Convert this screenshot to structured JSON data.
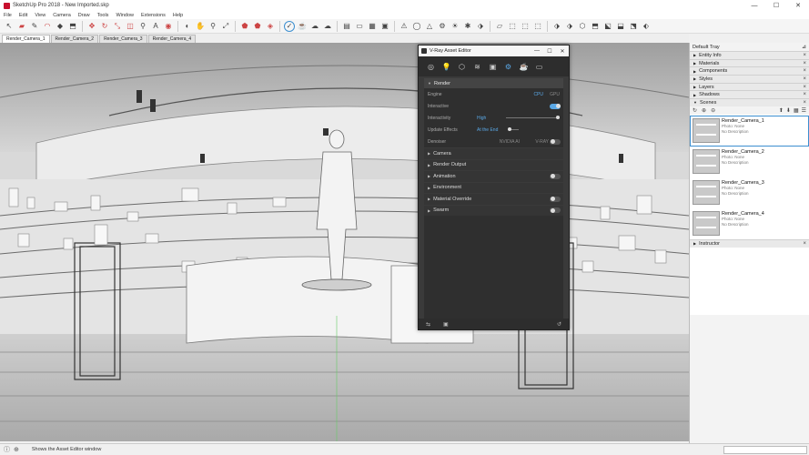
{
  "window": {
    "title": "SketchUp Pro 2018 - New Imported.skp"
  },
  "menu": [
    "File",
    "Edit",
    "View",
    "Camera",
    "Draw",
    "Tools",
    "Window",
    "Extensions",
    "Help"
  ],
  "toolbar_icons": [
    "select",
    "eraser",
    "line",
    "arc",
    "shape",
    "push-pull",
    "move",
    "rotate",
    "scale",
    "offset",
    "tape",
    "text",
    "paint",
    "orbit",
    "pan",
    "zoom",
    "zoom-extents",
    "vray-render",
    "vray-interactive",
    "vray-asset-editor",
    "vray-frame-buffer",
    "lights",
    "geometry",
    "section"
  ],
  "scene_tabs": [
    "Render_Camera_1",
    "Render_Camera_2",
    "Render_Camera_3",
    "Render_Camera_4"
  ],
  "active_scene_tab": 0,
  "status": {
    "text": "Shows the Asset Editor window"
  },
  "tray": {
    "title": "Default Tray",
    "panels": [
      "Entity Info",
      "Materials",
      "Components",
      "Styles",
      "Layers",
      "Shadows"
    ],
    "scenes_label": "Scenes",
    "scenes": [
      {
        "name": "Render_Camera_1",
        "photo": "Photo: None",
        "desc": "No Description"
      },
      {
        "name": "Render_Camera_2",
        "photo": "Photo: None",
        "desc": "No Description"
      },
      {
        "name": "Render_Camera_3",
        "photo": "Photo: None",
        "desc": "No Description"
      },
      {
        "name": "Render_Camera_4",
        "photo": "Photo: None",
        "desc": "No Description"
      }
    ],
    "instructor_label": "Instructor"
  },
  "vray": {
    "title": "V-Ray Asset Editor",
    "render_label": "Render",
    "engine_label": "Engine",
    "engine_cpu": "CPU",
    "engine_gpu": "GPU",
    "interactive_label": "Interactive",
    "interactivity_label": "Interactivity",
    "interactivity_value": "High",
    "update_effects_label": "Update Effects",
    "update_effects_value": "At the End",
    "denoiser_label": "Denoiser",
    "denoiser_nvidia": "NVIDIA AI",
    "denoiser_vray": "V-RAY",
    "sections": [
      "Camera",
      "Render Output",
      "Animation",
      "Environment",
      "Material Override",
      "Swarm"
    ]
  }
}
